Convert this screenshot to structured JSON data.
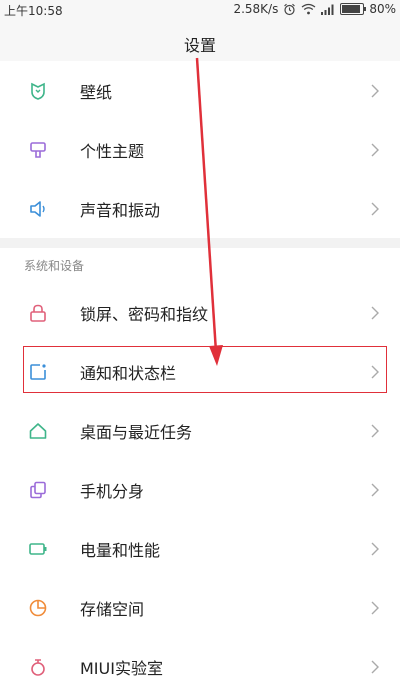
{
  "status_bar": {
    "time": "上午10:58",
    "speed": "2.58K/s",
    "battery": "80%",
    "battery_level": 0.8,
    "icons": [
      "alarm-icon",
      "wifi-icon",
      "signal-icon",
      "battery-icon"
    ]
  },
  "header": {
    "title": "设置"
  },
  "group1": [
    {
      "label": "壁纸",
      "icon": "wallpaper-icon"
    },
    {
      "label": "个性主题",
      "icon": "theme-icon"
    },
    {
      "label": "声音和振动",
      "icon": "sound-icon"
    }
  ],
  "section": {
    "title": "系统和设备"
  },
  "group2": [
    {
      "label": "锁屏、密码和指纹",
      "icon": "lock-icon"
    },
    {
      "label": "通知和状态栏",
      "icon": "notification-icon",
      "highlighted": true
    },
    {
      "label": "桌面与最近任务",
      "icon": "home-icon"
    },
    {
      "label": "手机分身",
      "icon": "clone-icon"
    },
    {
      "label": "电量和性能",
      "icon": "battery-icon"
    },
    {
      "label": "存储空间",
      "icon": "storage-icon"
    },
    {
      "label": "MIUI实验室",
      "icon": "lab-icon"
    }
  ],
  "colors": {
    "accent_red": "#e0303a",
    "icon_green": "#3fb58a",
    "icon_purple": "#9b6cd9",
    "icon_blue": "#3b8fd9",
    "icon_pink": "#e0607a",
    "icon_orange": "#f08c3a"
  }
}
